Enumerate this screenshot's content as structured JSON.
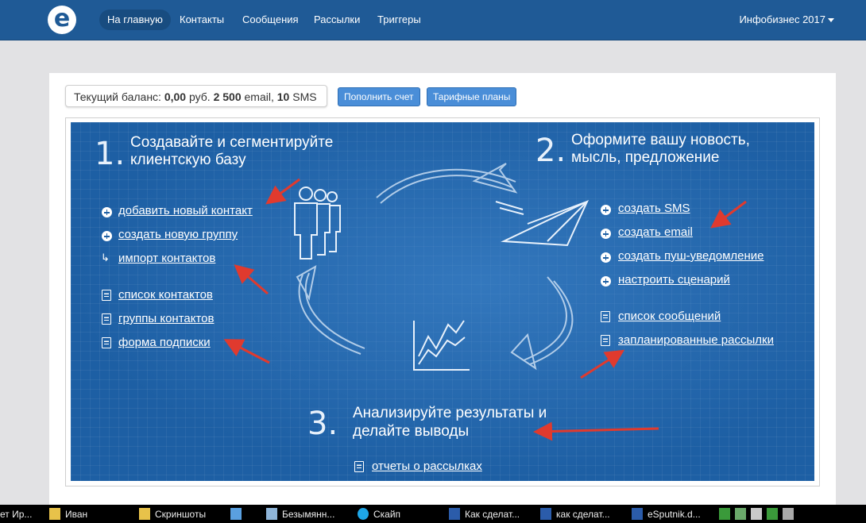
{
  "nav": {
    "logo": "e",
    "items": [
      {
        "label": "На главную",
        "active": true
      },
      {
        "label": "Контакты"
      },
      {
        "label": "Сообщения"
      },
      {
        "label": "Рассылки"
      },
      {
        "label": "Триггеры"
      }
    ],
    "user": "Инфобизнес 2017"
  },
  "balance": {
    "prefix": "Текущий баланс:",
    "amount": "0,00",
    "currency": "руб.",
    "emails": "2 500",
    "email_unit": "email,",
    "sms": "10",
    "sms_unit": "SMS"
  },
  "buttons": {
    "topup": "Пополнить счет",
    "plans": "Тарифные планы"
  },
  "steps": {
    "s1": {
      "num": "1.",
      "title1": "Создавайте и сегментируйте",
      "title2": "клиентскую базу"
    },
    "s2": {
      "num": "2.",
      "title1": "Оформите вашу новость,",
      "title2": "мысль, предложение"
    },
    "s3": {
      "num": "3.",
      "title1": "Анализируйте результаты и",
      "title2": "делайте выводы"
    }
  },
  "links_left": {
    "add_contact": "добавить новый контакт",
    "create_group": "создать новую группу",
    "import": "импорт контактов",
    "contact_list": "список контактов",
    "contact_groups": "группы контактов",
    "subscribe_form": "форма подписки"
  },
  "links_right": {
    "create_sms": "создать SMS",
    "create_email": "создать email",
    "create_push": "создать пуш-уведомление",
    "setup_scenario": "настроить сценарий",
    "message_list": "список сообщений",
    "scheduled": "запланированные рассылки"
  },
  "links_bottom": {
    "reports": "отчеты о рассылках"
  },
  "taskbar": {
    "items": [
      {
        "label": "ет Ир..."
      },
      {
        "label": "Иван"
      },
      {
        "label": "Скриншоты"
      },
      {
        "label": "Безымянн..."
      },
      {
        "label": "Скайп"
      },
      {
        "label": "Как сделат..."
      },
      {
        "label": "как сделат..."
      },
      {
        "label": "eSputnik.d..."
      }
    ]
  },
  "colors": {
    "navbar": "#1f5a96",
    "board": "#1d5fa4",
    "button": "#4a8ed8",
    "arrow": "#e03a2e"
  }
}
